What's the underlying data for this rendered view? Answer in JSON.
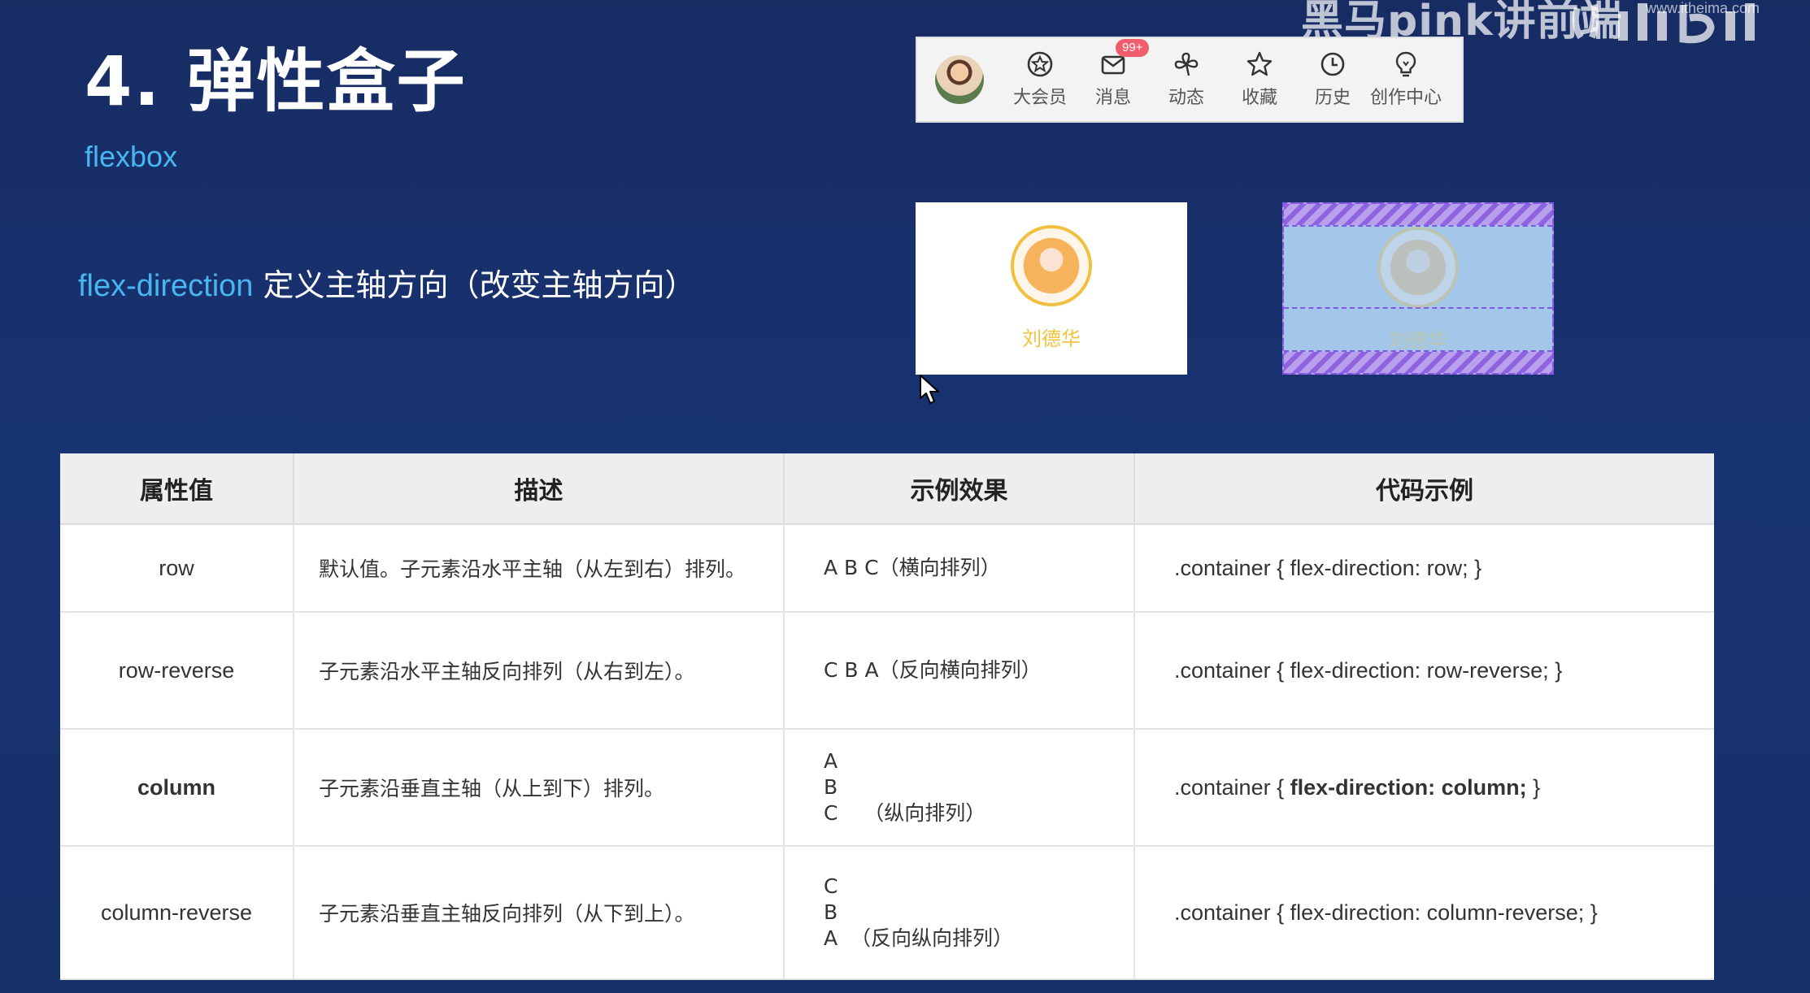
{
  "watermark": {
    "brand_text": "黑马pink讲前端",
    "url": "www.itheima.com",
    "logo_name": "bilibili-logo"
  },
  "slide": {
    "title": "4. 弹性盒子",
    "subtitle": "flexbox",
    "property_name": "flex-direction",
    "property_desc": " 定义主轴方向（改变主轴方向）"
  },
  "nav_bar": {
    "items": [
      {
        "label": "大会员",
        "icon": "vip-icon"
      },
      {
        "label": "消息",
        "icon": "mail-icon",
        "badge": "99+"
      },
      {
        "label": "动态",
        "icon": "pinwheel-icon"
      },
      {
        "label": "收藏",
        "icon": "star-icon"
      },
      {
        "label": "历史",
        "icon": "clock-icon"
      },
      {
        "label": "创作中心",
        "icon": "bulb-icon"
      }
    ]
  },
  "cards": {
    "normal_name": "刘德华",
    "highlighted_name": "刘德华"
  },
  "table": {
    "headers": [
      "属性值",
      "描述",
      "示例效果",
      "代码示例"
    ],
    "rows": [
      {
        "value": "row",
        "desc": "默认值。子元素沿水平主轴（从左到右）排列。",
        "example": [
          "A B C（横向排列）"
        ],
        "code_prefix": ".container { ",
        "code_body": "flex-direction: row;",
        "code_suffix": " }"
      },
      {
        "value": "row-reverse",
        "desc": "子元素沿水平主轴反向排列（从右到左）。",
        "example": [
          "C B A（反向横向排列）"
        ],
        "code_prefix": ".container { ",
        "code_body": "flex-direction: row-reverse;",
        "code_suffix": " }"
      },
      {
        "value": "column",
        "desc": "子元素沿垂直主轴（从上到下）排列。",
        "example": [
          "A",
          "B",
          "C    （纵向排列）"
        ],
        "code_prefix": ".container { ",
        "code_body": "flex-direction: column;",
        "code_suffix": " }"
      },
      {
        "value": "column-reverse",
        "desc": "子元素沿垂直主轴反向排列（从下到上）。",
        "example": [
          "C",
          "B",
          "A  （反向纵向排列）"
        ],
        "code_prefix": ".container { ",
        "code_body": "flex-direction: column-reverse;",
        "code_suffix": " }"
      }
    ]
  }
}
